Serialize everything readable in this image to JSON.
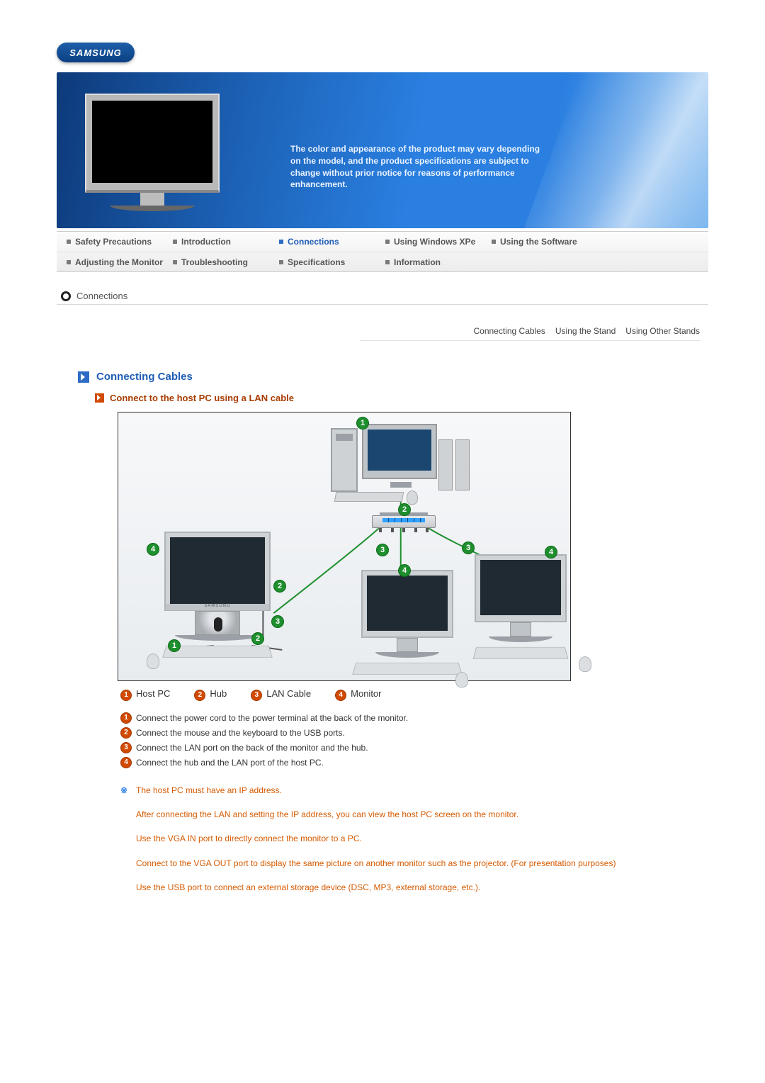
{
  "brand": "SAMSUNG",
  "hero_text": "The color and appearance of the product may vary depending on the model, and the product specifications are subject to change without prior notice for reasons of performance enhancement.",
  "nav": {
    "row1": [
      {
        "label": "Safety Precautions",
        "active": false
      },
      {
        "label": "Introduction",
        "active": false
      },
      {
        "label": "Connections",
        "active": true
      },
      {
        "label": "Using Windows XPe",
        "active": false
      },
      {
        "label": "Using the Software",
        "active": false
      }
    ],
    "row2": [
      {
        "label": "Adjusting the Monitor",
        "active": false
      },
      {
        "label": "Troubleshooting",
        "active": false
      },
      {
        "label": "Specifications",
        "active": false
      },
      {
        "label": "Information",
        "active": false
      }
    ]
  },
  "crumb": "Connections",
  "subtabs": [
    "Connecting Cables",
    "Using the Stand",
    "Using Other Stands"
  ],
  "section_title": "Connecting Cables",
  "subsection_title": "Connect to the host PC using a LAN cable",
  "legend": [
    {
      "n": "1",
      "label": "Host PC"
    },
    {
      "n": "2",
      "label": "Hub"
    },
    {
      "n": "3",
      "label": "LAN Cable"
    },
    {
      "n": "4",
      "label": "Monitor"
    }
  ],
  "diagram_badges": {
    "b1": "1",
    "b2": "2",
    "b3": "3",
    "b4": "4"
  },
  "steps": [
    {
      "n": "1",
      "t": "Connect the power cord to the power terminal at the back of the monitor."
    },
    {
      "n": "2",
      "t": "Connect the mouse and the keyboard to the USB ports."
    },
    {
      "n": "3",
      "t": "Connect the LAN port on the back of the monitor and the hub."
    },
    {
      "n": "4",
      "t": "Connect the hub and the LAN port of the host PC."
    }
  ],
  "notes": [
    "The host PC must have an IP address.",
    "After connecting the LAN and setting the IP address, you can view the host PC screen on the monitor.",
    "Use the VGA IN port to directly connect the monitor to a PC.",
    "Connect to the VGA OUT port to display the same picture on another monitor such as the projector. (For presentation purposes)",
    "Use the USB port to connect an external storage device (DSC, MP3, external storage, etc.)."
  ]
}
